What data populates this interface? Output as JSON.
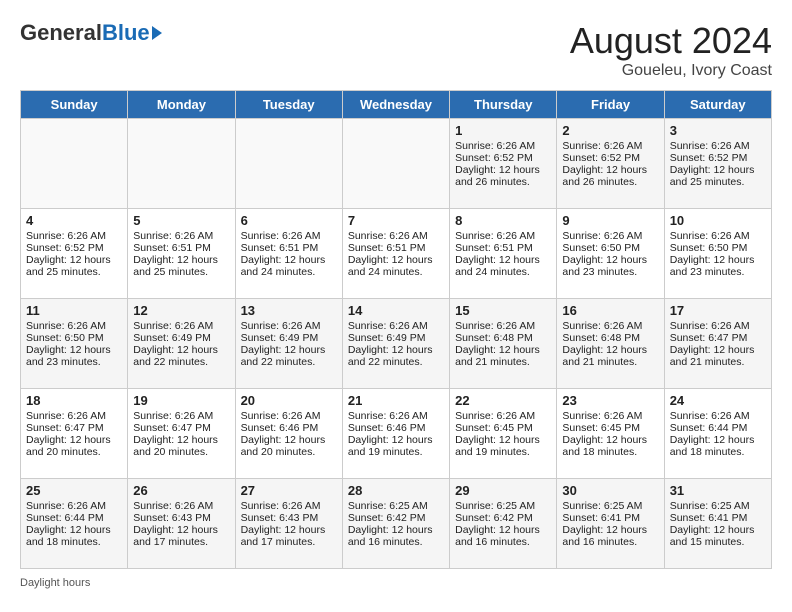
{
  "header": {
    "logo_general": "General",
    "logo_blue": "Blue",
    "month_title": "August 2024",
    "location": "Goueleu, Ivory Coast"
  },
  "days_of_week": [
    "Sunday",
    "Monday",
    "Tuesday",
    "Wednesday",
    "Thursday",
    "Friday",
    "Saturday"
  ],
  "weeks": [
    [
      {
        "day": "",
        "content": ""
      },
      {
        "day": "",
        "content": ""
      },
      {
        "day": "",
        "content": ""
      },
      {
        "day": "",
        "content": ""
      },
      {
        "day": "1",
        "content": "Sunrise: 6:26 AM\nSunset: 6:52 PM\nDaylight: 12 hours and 26 minutes."
      },
      {
        "day": "2",
        "content": "Sunrise: 6:26 AM\nSunset: 6:52 PM\nDaylight: 12 hours and 26 minutes."
      },
      {
        "day": "3",
        "content": "Sunrise: 6:26 AM\nSunset: 6:52 PM\nDaylight: 12 hours and 25 minutes."
      }
    ],
    [
      {
        "day": "4",
        "content": "Sunrise: 6:26 AM\nSunset: 6:52 PM\nDaylight: 12 hours and 25 minutes."
      },
      {
        "day": "5",
        "content": "Sunrise: 6:26 AM\nSunset: 6:51 PM\nDaylight: 12 hours and 25 minutes."
      },
      {
        "day": "6",
        "content": "Sunrise: 6:26 AM\nSunset: 6:51 PM\nDaylight: 12 hours and 24 minutes."
      },
      {
        "day": "7",
        "content": "Sunrise: 6:26 AM\nSunset: 6:51 PM\nDaylight: 12 hours and 24 minutes."
      },
      {
        "day": "8",
        "content": "Sunrise: 6:26 AM\nSunset: 6:51 PM\nDaylight: 12 hours and 24 minutes."
      },
      {
        "day": "9",
        "content": "Sunrise: 6:26 AM\nSunset: 6:50 PM\nDaylight: 12 hours and 23 minutes."
      },
      {
        "day": "10",
        "content": "Sunrise: 6:26 AM\nSunset: 6:50 PM\nDaylight: 12 hours and 23 minutes."
      }
    ],
    [
      {
        "day": "11",
        "content": "Sunrise: 6:26 AM\nSunset: 6:50 PM\nDaylight: 12 hours and 23 minutes."
      },
      {
        "day": "12",
        "content": "Sunrise: 6:26 AM\nSunset: 6:49 PM\nDaylight: 12 hours and 22 minutes."
      },
      {
        "day": "13",
        "content": "Sunrise: 6:26 AM\nSunset: 6:49 PM\nDaylight: 12 hours and 22 minutes."
      },
      {
        "day": "14",
        "content": "Sunrise: 6:26 AM\nSunset: 6:49 PM\nDaylight: 12 hours and 22 minutes."
      },
      {
        "day": "15",
        "content": "Sunrise: 6:26 AM\nSunset: 6:48 PM\nDaylight: 12 hours and 21 minutes."
      },
      {
        "day": "16",
        "content": "Sunrise: 6:26 AM\nSunset: 6:48 PM\nDaylight: 12 hours and 21 minutes."
      },
      {
        "day": "17",
        "content": "Sunrise: 6:26 AM\nSunset: 6:47 PM\nDaylight: 12 hours and 21 minutes."
      }
    ],
    [
      {
        "day": "18",
        "content": "Sunrise: 6:26 AM\nSunset: 6:47 PM\nDaylight: 12 hours and 20 minutes."
      },
      {
        "day": "19",
        "content": "Sunrise: 6:26 AM\nSunset: 6:47 PM\nDaylight: 12 hours and 20 minutes."
      },
      {
        "day": "20",
        "content": "Sunrise: 6:26 AM\nSunset: 6:46 PM\nDaylight: 12 hours and 20 minutes."
      },
      {
        "day": "21",
        "content": "Sunrise: 6:26 AM\nSunset: 6:46 PM\nDaylight: 12 hours and 19 minutes."
      },
      {
        "day": "22",
        "content": "Sunrise: 6:26 AM\nSunset: 6:45 PM\nDaylight: 12 hours and 19 minutes."
      },
      {
        "day": "23",
        "content": "Sunrise: 6:26 AM\nSunset: 6:45 PM\nDaylight: 12 hours and 18 minutes."
      },
      {
        "day": "24",
        "content": "Sunrise: 6:26 AM\nSunset: 6:44 PM\nDaylight: 12 hours and 18 minutes."
      }
    ],
    [
      {
        "day": "25",
        "content": "Sunrise: 6:26 AM\nSunset: 6:44 PM\nDaylight: 12 hours and 18 minutes."
      },
      {
        "day": "26",
        "content": "Sunrise: 6:26 AM\nSunset: 6:43 PM\nDaylight: 12 hours and 17 minutes."
      },
      {
        "day": "27",
        "content": "Sunrise: 6:26 AM\nSunset: 6:43 PM\nDaylight: 12 hours and 17 minutes."
      },
      {
        "day": "28",
        "content": "Sunrise: 6:25 AM\nSunset: 6:42 PM\nDaylight: 12 hours and 16 minutes."
      },
      {
        "day": "29",
        "content": "Sunrise: 6:25 AM\nSunset: 6:42 PM\nDaylight: 12 hours and 16 minutes."
      },
      {
        "day": "30",
        "content": "Sunrise: 6:25 AM\nSunset: 6:41 PM\nDaylight: 12 hours and 16 minutes."
      },
      {
        "day": "31",
        "content": "Sunrise: 6:25 AM\nSunset: 6:41 PM\nDaylight: 12 hours and 15 minutes."
      }
    ]
  ],
  "footer": {
    "label": "Daylight hours"
  }
}
